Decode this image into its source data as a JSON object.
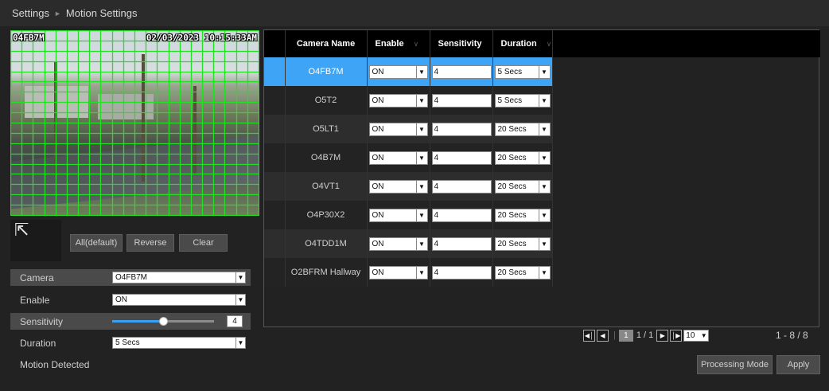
{
  "breadcrumb": {
    "root": "Settings",
    "separator": "►",
    "current": "Motion Settings"
  },
  "preview": {
    "osd_name": "04FB7M",
    "osd_datetime": "02/03/2023 10:15:33AM"
  },
  "area_buttons": {
    "all": "All(default)",
    "reverse": "Reverse",
    "clear": "Clear"
  },
  "settings": {
    "camera_label": "Camera",
    "camera_value": "O4FB7M",
    "enable_label": "Enable",
    "enable_value": "ON",
    "sensitivity_label": "Sensitivity",
    "sensitivity_value": "4",
    "sensitivity_level": 0.5,
    "duration_label": "Duration",
    "duration_value": "5 Secs"
  },
  "table": {
    "headers": {
      "camera": "Camera Name",
      "enable": "Enable",
      "sensitivity": "Sensitivity",
      "duration": "Duration"
    },
    "rows": [
      {
        "name": "O4FB7M",
        "enable": "ON",
        "sensitivity": "4",
        "duration": "5 Secs"
      },
      {
        "name": "O5T2",
        "enable": "ON",
        "sensitivity": "4",
        "duration": "5 Secs"
      },
      {
        "name": "O5LT1",
        "enable": "ON",
        "sensitivity": "4",
        "duration": "20 Secs"
      },
      {
        "name": "O4B7M",
        "enable": "ON",
        "sensitivity": "4",
        "duration": "20 Secs"
      },
      {
        "name": "O4VT1",
        "enable": "ON",
        "sensitivity": "4",
        "duration": "20 Secs"
      },
      {
        "name": "O4P30X2",
        "enable": "ON",
        "sensitivity": "4",
        "duration": "20 Secs"
      },
      {
        "name": "O4TDD1M",
        "enable": "ON",
        "sensitivity": "4",
        "duration": "20 Secs"
      },
      {
        "name": "O2BFRM Hallway",
        "enable": "ON",
        "sensitivity": "4",
        "duration": "20 Secs"
      }
    ],
    "selected_index": 0
  },
  "pager": {
    "current_page": "1",
    "page_text": "1 / 1",
    "page_size": "10",
    "count_text": "1 - 8 / 8"
  },
  "footer": {
    "motion_label": "Motion Detected",
    "processing_mode": "Processing Mode",
    "apply": "Apply"
  },
  "colors": {
    "accent": "#3ea4f5",
    "grid": "#22e022"
  }
}
